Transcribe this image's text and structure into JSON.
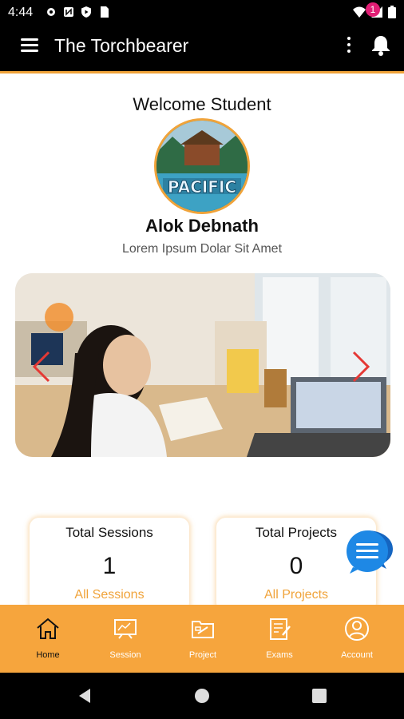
{
  "status_bar": {
    "time": "4:44",
    "left_icons": [
      "settings-icon",
      "nfc-icon",
      "shield-play-icon",
      "sd-card-icon"
    ],
    "right_icons": [
      "wifi-icon",
      "signal-icon",
      "battery-icon"
    ]
  },
  "app_bar": {
    "title": "The Torchbearer",
    "notification_count": "1"
  },
  "profile": {
    "welcome": "Welcome Student",
    "avatar_caption": "PACIFIC",
    "name": "Alok Debnath",
    "subtitle": "Lorem Ipsum Dolar Sit Amet"
  },
  "stats": [
    {
      "title": "Total Sessions",
      "value": "1",
      "link": "All Sessions"
    },
    {
      "title": "Total Projects",
      "value": "0",
      "link": "All Projects"
    }
  ],
  "bottom_nav": [
    {
      "label": "Home",
      "icon": "home-icon",
      "active": true
    },
    {
      "label": "Session",
      "icon": "session-icon",
      "active": false
    },
    {
      "label": "Project",
      "icon": "project-icon",
      "active": false
    },
    {
      "label": "Exams",
      "icon": "exams-icon",
      "active": false
    },
    {
      "label": "Account",
      "icon": "account-icon",
      "active": false
    }
  ],
  "colors": {
    "accent": "#f0a33a",
    "nav_bg": "#f6a53d",
    "badge": "#e11d74",
    "chat": "#1e88e5"
  }
}
